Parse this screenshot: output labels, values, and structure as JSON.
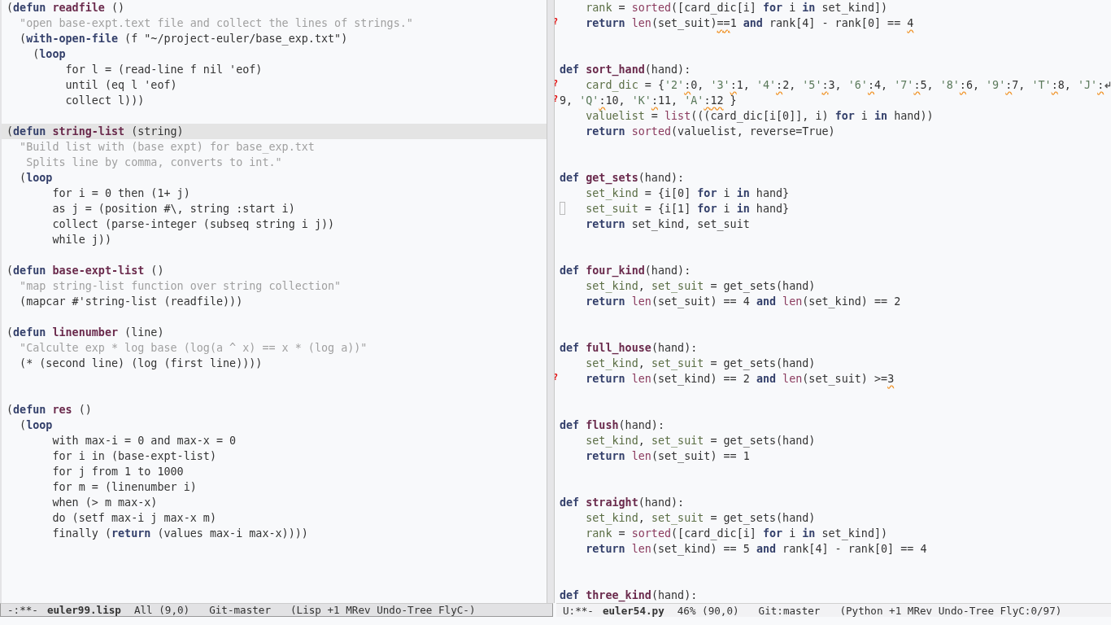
{
  "left_window": {
    "lines": [
      {
        "current": false,
        "tokens": [
          "(",
          {
            "kind": "keyword",
            "text": "defun"
          },
          {
            "kind": "function",
            "text": " readfile"
          },
          " ()"
        ]
      },
      {
        "current": false,
        "tokens": [
          {
            "kind": "string",
            "text": "  \"open base-expt.text file and collect the lines of strings.\""
          }
        ]
      },
      {
        "current": false,
        "tokens": [
          "  (",
          {
            "kind": "keyword",
            "text": "with-open-file"
          },
          " (f \"~/project-euler/base_exp.txt\")"
        ]
      },
      {
        "current": false,
        "tokens": [
          "    (",
          {
            "kind": "keyword",
            "text": "loop"
          }
        ]
      },
      {
        "current": false,
        "tokens": [
          "         for l = (read-line f nil 'eof)"
        ]
      },
      {
        "current": false,
        "tokens": [
          "         until (eq l 'eof)"
        ]
      },
      {
        "current": false,
        "tokens": [
          "         collect l)))"
        ]
      },
      {
        "current": false
      },
      {
        "current": true,
        "tokens": [
          "(",
          {
            "kind": "keyword",
            "text": "defun"
          },
          {
            "kind": "function",
            "text": " string-list"
          },
          " (string)"
        ]
      },
      {
        "current": false,
        "tokens": [
          {
            "kind": "string",
            "text": "  \"Build list with (base expt) for base_exp.txt"
          }
        ]
      },
      {
        "current": false,
        "tokens": [
          {
            "kind": "string",
            "text": "   Splits line by comma, converts to int.\""
          }
        ]
      },
      {
        "current": false,
        "tokens": [
          "  (",
          {
            "kind": "keyword",
            "text": "loop"
          }
        ]
      },
      {
        "current": false,
        "tokens": [
          "       for i = 0 then (1+ j)"
        ]
      },
      {
        "current": false,
        "tokens": [
          "       as j = (position #\\, string :start i)"
        ]
      },
      {
        "current": false,
        "tokens": [
          "       collect (parse-integer (subseq string i j))"
        ]
      },
      {
        "current": false,
        "tokens": [
          "       while j))"
        ]
      },
      {
        "current": false
      },
      {
        "current": false,
        "tokens": [
          "(",
          {
            "kind": "keyword",
            "text": "defun"
          },
          {
            "kind": "function",
            "text": " base-expt-list"
          },
          " ()"
        ]
      },
      {
        "current": false,
        "tokens": [
          {
            "kind": "string",
            "text": "  \"map string-list function over string collection\""
          }
        ]
      },
      {
        "current": false,
        "tokens": [
          "  (mapcar #'string-list (readfile)))"
        ]
      },
      {
        "current": false
      },
      {
        "current": false,
        "tokens": [
          "(",
          {
            "kind": "keyword",
            "text": "defun"
          },
          {
            "kind": "function",
            "text": " linenumber"
          },
          " (line)"
        ]
      },
      {
        "current": false,
        "tokens": [
          {
            "kind": "string",
            "text": "  \"Calculte exp * log base (log(a ^ x) == x * (log a))\""
          }
        ]
      },
      {
        "current": false,
        "tokens": [
          "  (* (second line) (log (first line))))"
        ]
      },
      {
        "current": false
      },
      {
        "current": false
      },
      {
        "current": false,
        "tokens": [
          "(",
          {
            "kind": "keyword",
            "text": "defun"
          },
          {
            "kind": "function",
            "text": " res"
          },
          " ()"
        ]
      },
      {
        "current": false,
        "tokens": [
          "  (",
          {
            "kind": "keyword",
            "text": "loop"
          }
        ]
      },
      {
        "current": false,
        "tokens": [
          "       with max-i = 0 and max-x = 0"
        ]
      },
      {
        "current": false,
        "tokens": [
          "       for i in (base-expt-list)"
        ]
      },
      {
        "current": false,
        "tokens": [
          "       for j from 1 to 1000"
        ]
      },
      {
        "current": false,
        "tokens": [
          "       for m = (linenumber i)"
        ]
      },
      {
        "current": false,
        "tokens": [
          "       when (> m max-x)"
        ]
      },
      {
        "current": false,
        "tokens": [
          "       do (setf max-i j max-x m)"
        ]
      },
      {
        "current": false,
        "tokens": [
          "       finally (",
          {
            "kind": "keyword",
            "text": "return"
          },
          " (values max-i max-x))))"
        ]
      }
    ],
    "mode_line": {
      "active": true,
      "state": "-:**-",
      "buffer": "euler99.lisp",
      "position": "All (9,0)",
      "vc": "Git-master",
      "modes": "(Lisp +1 MRev Undo-Tree FlyC-)"
    }
  },
  "right_window": {
    "lines": [
      {
        "cursor": false,
        "wrapped": false,
        "tokens": [
          {
            "kind": "variable",
            "text": "    rank"
          },
          " = ",
          {
            "kind": "builtin",
            "text": "sorted"
          },
          "([card_dic[i] ",
          {
            "kind": "keyword",
            "text": "for"
          },
          " i ",
          {
            "kind": "keyword",
            "text": "in"
          },
          " set_kind])"
        ]
      },
      {
        "cursor": false,
        "wrapped": false,
        "fringe": "?",
        "tokens": [
          {
            "kind": "keyword",
            "text": "    return"
          },
          {
            "kind": "builtin",
            "text": " len"
          },
          "(set_suit)",
          {
            "kind": "flagged",
            "text": "=="
          },
          "1 ",
          {
            "kind": "keyword",
            "text": "and"
          },
          " rank[4] - rank[0] == ",
          {
            "kind": "flagged",
            "text": "4"
          }
        ]
      },
      {
        "cursor": false,
        "wrapped": false
      },
      {
        "cursor": false,
        "wrapped": false
      },
      {
        "cursor": false,
        "wrapped": false,
        "tokens": [
          {
            "kind": "keyword",
            "text": "def"
          },
          {
            "kind": "function",
            "text": " sort_hand"
          },
          "(hand):"
        ]
      },
      {
        "cursor": false,
        "wrapped": true,
        "fringe": "?",
        "tokens": [
          {
            "kind": "variable",
            "text": "    card_dic"
          },
          " = {",
          {
            "kind": "literal",
            "text": "'2'"
          },
          {
            "kind": "flagged",
            "text": ":"
          },
          "0, ",
          {
            "kind": "literal",
            "text": "'3'"
          },
          {
            "kind": "flagged",
            "text": ":"
          },
          "1, ",
          {
            "kind": "literal",
            "text": "'4'"
          },
          {
            "kind": "flagged",
            "text": ":"
          },
          "2, ",
          {
            "kind": "literal",
            "text": "'5'"
          },
          {
            "kind": "flagged",
            "text": ":"
          },
          "3, ",
          {
            "kind": "literal",
            "text": "'6'"
          },
          {
            "kind": "flagged",
            "text": ":"
          },
          "4, ",
          {
            "kind": "literal",
            "text": "'7'"
          },
          {
            "kind": "flagged",
            "text": ":"
          },
          "5, ",
          {
            "kind": "literal",
            "text": "'8'"
          },
          {
            "kind": "flagged",
            "text": ":"
          },
          "6, ",
          {
            "kind": "literal",
            "text": "'9'"
          },
          {
            "kind": "flagged",
            "text": ":"
          },
          "7, ",
          {
            "kind": "literal",
            "text": "'T'"
          },
          {
            "kind": "flagged",
            "text": ":"
          },
          "8, ",
          {
            "kind": "literal",
            "text": "'J'"
          },
          {
            "kind": "flagged",
            "text": ":"
          }
        ]
      },
      {
        "cursor": false,
        "wrapped": false,
        "fringe": "?",
        "tokens": [
          "9, ",
          {
            "kind": "literal",
            "text": "'Q'"
          },
          {
            "kind": "flagged",
            "text": ":"
          },
          "10, ",
          {
            "kind": "literal",
            "text": "'K'"
          },
          {
            "kind": "flagged",
            "text": ":"
          },
          "11, ",
          {
            "kind": "literal",
            "text": "'A'"
          },
          {
            "kind": "flagged",
            "text": ":"
          },
          {
            "kind": "flagged",
            "text": "12"
          },
          " }"
        ]
      },
      {
        "cursor": false,
        "wrapped": false,
        "tokens": [
          {
            "kind": "variable",
            "text": "    valuelist"
          },
          " = ",
          {
            "kind": "builtin",
            "text": "list"
          },
          "(((card_dic[i[0]], i) ",
          {
            "kind": "keyword",
            "text": "for"
          },
          " i ",
          {
            "kind": "keyword",
            "text": "in"
          },
          " hand))"
        ]
      },
      {
        "cursor": false,
        "wrapped": false,
        "tokens": [
          {
            "kind": "keyword",
            "text": "    return"
          },
          {
            "kind": "builtin",
            "text": " sorted"
          },
          "(valuelist, reverse=True)"
        ]
      },
      {
        "cursor": false,
        "wrapped": false
      },
      {
        "cursor": false,
        "wrapped": false
      },
      {
        "cursor": false,
        "wrapped": false,
        "tokens": [
          {
            "kind": "keyword",
            "text": "def"
          },
          {
            "kind": "function",
            "text": " get_sets"
          },
          "(hand):"
        ]
      },
      {
        "cursor": false,
        "wrapped": false,
        "tokens": [
          {
            "kind": "variable",
            "text": "    set_kind"
          },
          " = {i[0] ",
          {
            "kind": "keyword",
            "text": "for"
          },
          " i ",
          {
            "kind": "keyword",
            "text": "in"
          },
          " hand}"
        ]
      },
      {
        "cursor": true,
        "wrapped": false,
        "tokens": [
          {
            "kind": "variable",
            "text": "    set_suit"
          },
          " = {i[1] ",
          {
            "kind": "keyword",
            "text": "for"
          },
          " i ",
          {
            "kind": "keyword",
            "text": "in"
          },
          " hand}"
        ]
      },
      {
        "cursor": false,
        "wrapped": false,
        "tokens": [
          {
            "kind": "keyword",
            "text": "    return"
          },
          " set_kind, set_suit"
        ]
      },
      {
        "cursor": false,
        "wrapped": false
      },
      {
        "cursor": false,
        "wrapped": false
      },
      {
        "cursor": false,
        "wrapped": false,
        "tokens": [
          {
            "kind": "keyword",
            "text": "def"
          },
          {
            "kind": "function",
            "text": " four_kind"
          },
          "(hand):"
        ]
      },
      {
        "cursor": false,
        "wrapped": false,
        "tokens": [
          {
            "kind": "variable",
            "text": "    set_kind"
          },
          ", ",
          {
            "kind": "variable",
            "text": "set_suit"
          },
          " = get_sets(hand)"
        ]
      },
      {
        "cursor": false,
        "wrapped": false,
        "tokens": [
          {
            "kind": "keyword",
            "text": "    return"
          },
          {
            "kind": "builtin",
            "text": " len"
          },
          "(set_suit) == 4 ",
          {
            "kind": "keyword",
            "text": "and"
          },
          {
            "kind": "builtin",
            "text": " len"
          },
          "(set_kind) == 2"
        ]
      },
      {
        "cursor": false,
        "wrapped": false
      },
      {
        "cursor": false,
        "wrapped": false
      },
      {
        "cursor": false,
        "wrapped": false,
        "tokens": [
          {
            "kind": "keyword",
            "text": "def"
          },
          {
            "kind": "function",
            "text": " full_house"
          },
          "(hand):"
        ]
      },
      {
        "cursor": false,
        "wrapped": false,
        "tokens": [
          {
            "kind": "variable",
            "text": "    set_kind"
          },
          ", ",
          {
            "kind": "variable",
            "text": "set_suit"
          },
          " = get_sets(hand)"
        ]
      },
      {
        "cursor": false,
        "wrapped": false,
        "fringe": "?",
        "tokens": [
          {
            "kind": "keyword",
            "text": "    return"
          },
          {
            "kind": "builtin",
            "text": " len"
          },
          "(set_kind) == 2 ",
          {
            "kind": "keyword",
            "text": "and"
          },
          {
            "kind": "builtin",
            "text": " len"
          },
          "(set_suit) >=",
          {
            "kind": "flagged",
            "text": "3"
          }
        ]
      },
      {
        "cursor": false,
        "wrapped": false
      },
      {
        "cursor": false,
        "wrapped": false
      },
      {
        "cursor": false,
        "wrapped": false,
        "tokens": [
          {
            "kind": "keyword",
            "text": "def"
          },
          {
            "kind": "function",
            "text": " flush"
          },
          "(hand):"
        ]
      },
      {
        "cursor": false,
        "wrapped": false,
        "tokens": [
          {
            "kind": "variable",
            "text": "    set_kind"
          },
          ", ",
          {
            "kind": "variable",
            "text": "set_suit"
          },
          " = get_sets(hand)"
        ]
      },
      {
        "cursor": false,
        "wrapped": false,
        "tokens": [
          {
            "kind": "keyword",
            "text": "    return"
          },
          {
            "kind": "builtin",
            "text": " len"
          },
          "(set_suit) == 1"
        ]
      },
      {
        "cursor": false,
        "wrapped": false
      },
      {
        "cursor": false,
        "wrapped": false
      },
      {
        "cursor": false,
        "wrapped": false,
        "tokens": [
          {
            "kind": "keyword",
            "text": "def"
          },
          {
            "kind": "function",
            "text": " straight"
          },
          "(hand):"
        ]
      },
      {
        "cursor": false,
        "wrapped": false,
        "tokens": [
          {
            "kind": "variable",
            "text": "    set_kind"
          },
          ", ",
          {
            "kind": "variable",
            "text": "set_suit"
          },
          " = get_sets(hand)"
        ]
      },
      {
        "cursor": false,
        "wrapped": false,
        "tokens": [
          {
            "kind": "variable",
            "text": "    rank"
          },
          " = ",
          {
            "kind": "builtin",
            "text": "sorted"
          },
          "([card_dic[i] ",
          {
            "kind": "keyword",
            "text": "for"
          },
          " i ",
          {
            "kind": "keyword",
            "text": "in"
          },
          " set_kind])"
        ]
      },
      {
        "cursor": false,
        "wrapped": false,
        "tokens": [
          {
            "kind": "keyword",
            "text": "    return"
          },
          {
            "kind": "builtin",
            "text": " len"
          },
          "(set_kind) == 5 ",
          {
            "kind": "keyword",
            "text": "and"
          },
          " rank[4] - rank[0] == 4"
        ]
      },
      {
        "cursor": false,
        "wrapped": false
      },
      {
        "cursor": false,
        "wrapped": false
      },
      {
        "cursor": false,
        "wrapped": false,
        "tokens": [
          {
            "kind": "keyword",
            "text": "def"
          },
          {
            "kind": "function",
            "text": " three_kind"
          },
          "(hand):"
        ]
      }
    ],
    "mode_line": {
      "active": false,
      "state": "U:**-",
      "buffer": "euler54.py",
      "position": "46% (90,0)",
      "vc": "Git:master",
      "modes": "(Python +1 MRev Undo-Tree FlyC:0/97)"
    }
  }
}
